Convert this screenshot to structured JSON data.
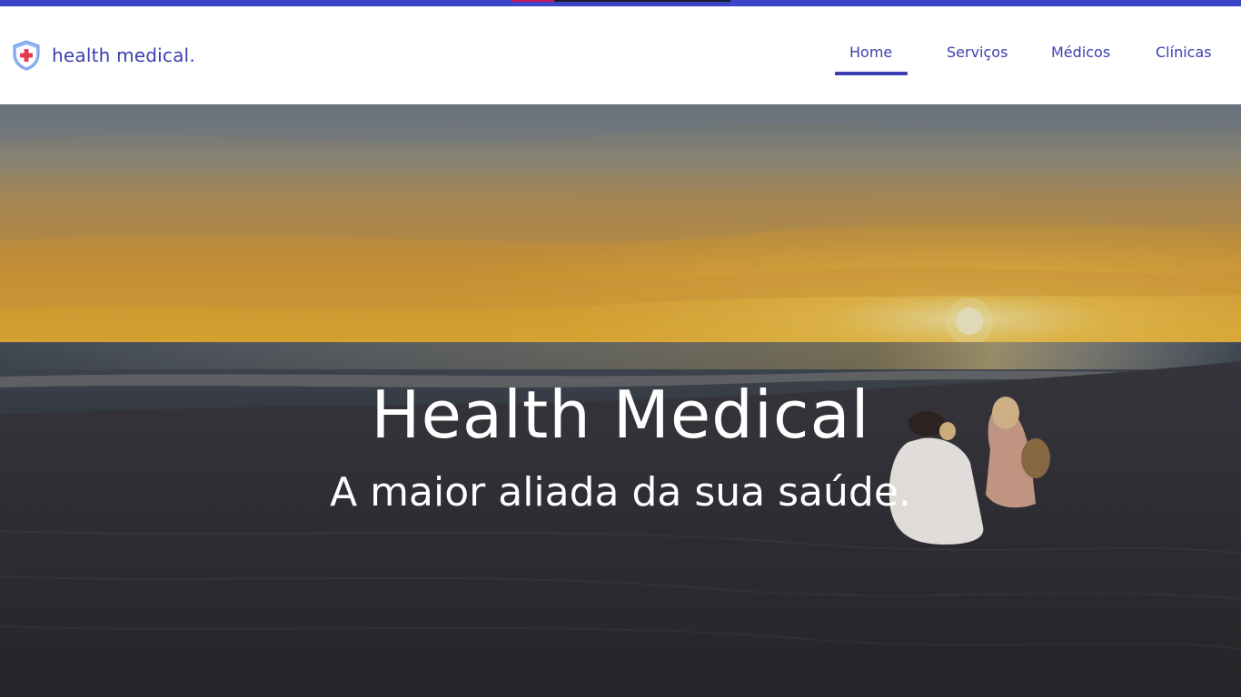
{
  "brand": {
    "name": "health medical.",
    "icon": "shield-cross-icon"
  },
  "nav": {
    "items": [
      {
        "label": "Home",
        "active": true
      },
      {
        "label": "Serviços",
        "active": false
      },
      {
        "label": "Médicos",
        "active": false
      },
      {
        "label": "Clínicas",
        "active": false
      }
    ]
  },
  "hero": {
    "title": "Health Medical",
    "subtitle": "A maior aliada da sua saúde."
  },
  "colors": {
    "accent": "#3b3fb0",
    "top_bar": "#3c45c8",
    "hero_text": "#ffffff"
  }
}
